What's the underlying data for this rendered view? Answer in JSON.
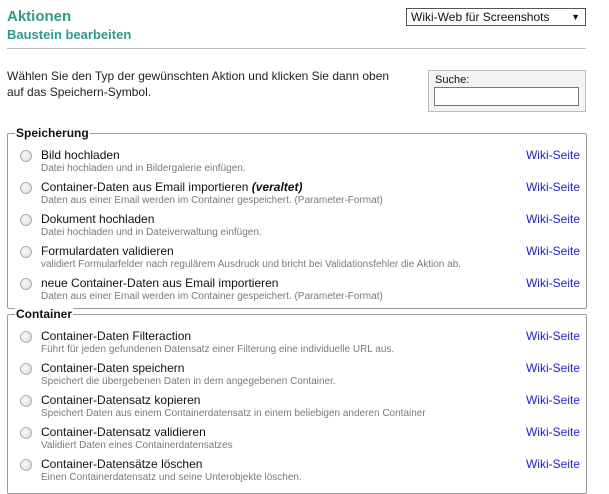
{
  "header": {
    "title": "Aktionen",
    "subtitle": "Baustein bearbeiten",
    "select_value": "Wiki-Web für Screenshots"
  },
  "intro_text": "Wählen Sie den Typ der gewünschten Aktion und klicken Sie dann oben auf das Speichern-Symbol.",
  "search": {
    "label": "Suche:",
    "value": ""
  },
  "groups": [
    {
      "legend": "Speicherung",
      "items": [
        {
          "title": "Bild hochladen",
          "tag": "",
          "desc": "Datei hochladen und in Bildergalerie einfügen.",
          "link": "Wiki-Seite"
        },
        {
          "title": "Container-Daten aus Email importieren",
          "tag": "(veraltet)",
          "desc": "Daten aus einer Email werden im Container gespeichert. (Parameter-Format)",
          "link": "Wiki-Seite"
        },
        {
          "title": "Dokument hochladen",
          "tag": "",
          "desc": "Datei hochladen und in Dateiverwaltung einfügen.",
          "link": "Wiki-Seite"
        },
        {
          "title": "Formulardaten validieren",
          "tag": "",
          "desc": "validiert Formularfelder nach regulärem Ausdruck und bricht bei Validationsfehler die Aktion ab.",
          "link": "Wiki-Seite"
        },
        {
          "title": "neue Container-Daten aus Email importieren",
          "tag": "",
          "desc": "Daten aus einer Email werden im Container gespeichert. (Parameter-Format)",
          "link": "Wiki-Seite"
        }
      ]
    },
    {
      "legend": "Container",
      "items": [
        {
          "title": "Container-Daten Filteraction",
          "tag": "",
          "desc": "Führt für jeden gefundenen Datensatz einer Filterung eine individuelle URL aus.",
          "link": "Wiki-Seite"
        },
        {
          "title": "Container-Daten speichern",
          "tag": "",
          "desc": "Speichert die übergebenen Daten in dem angegebenen Container.",
          "link": "Wiki-Seite"
        },
        {
          "title": "Container-Datensatz kopieren",
          "tag": "",
          "desc": "Speichert Daten aus einem Containerdatensatz in einem beliebigen anderen Container",
          "link": "Wiki-Seite"
        },
        {
          "title": "Container-Datensatz validieren",
          "tag": "",
          "desc": "Validiert Daten eines Containerdatensatzes",
          "link": "Wiki-Seite"
        },
        {
          "title": "Container-Datensätze löschen",
          "tag": "",
          "desc": "Einen Containerdatensatz und seine Unterobjekte löschen.",
          "link": "Wiki-Seite"
        }
      ]
    }
  ]
}
